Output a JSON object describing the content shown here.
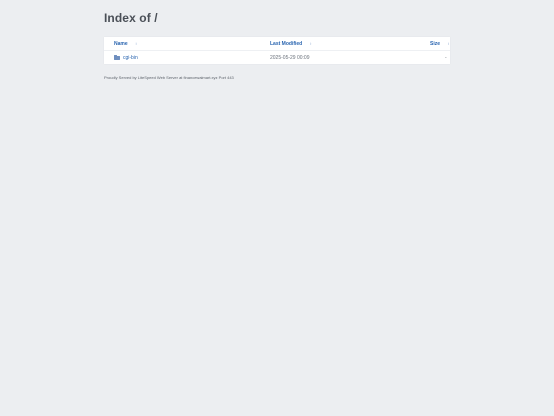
{
  "page": {
    "title": "Index of /"
  },
  "table": {
    "headers": {
      "name": "Name",
      "last_modified": "Last Modified",
      "size": "Size",
      "sort_indicator": "↕"
    },
    "rows": [
      {
        "icon": "folder-icon",
        "name": "cgi-bin",
        "last_modified": "2025-05-29 00:09",
        "size": "-"
      }
    ]
  },
  "footer": {
    "text": "Proudly Served by LiteSpeed Web Server at financewalmart.xyz Port 443"
  },
  "colors": {
    "background": "#eceef1",
    "link": "#2a65b0",
    "text": "#6b727c"
  }
}
